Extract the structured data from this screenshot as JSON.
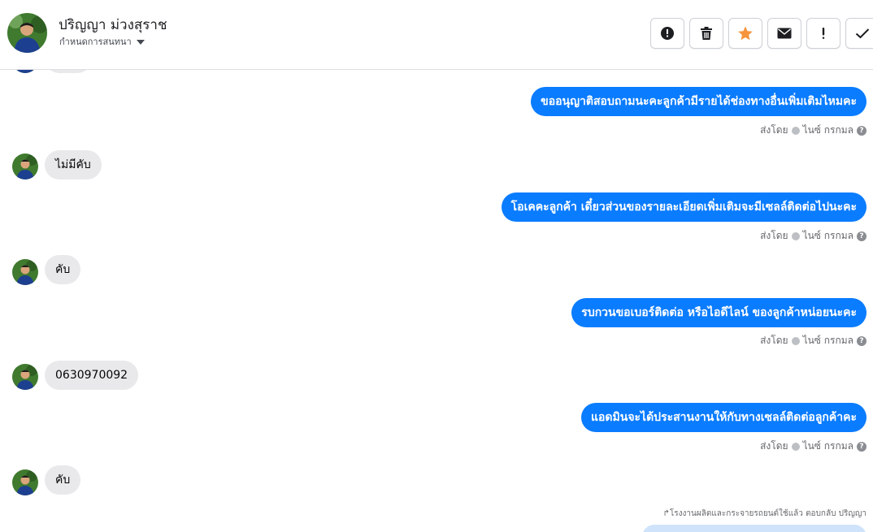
{
  "header": {
    "contact_name": "ปริญญา ม่วงสุราช",
    "assign_label": "กำหนดการสนทนา",
    "toolbar": [
      {
        "name": "spam-button",
        "icon": "alert-circle-icon"
      },
      {
        "name": "delete-button",
        "icon": "trash-icon"
      },
      {
        "name": "star-button",
        "icon": "star-icon"
      },
      {
        "name": "mark-unread-button",
        "icon": "envelope-icon"
      },
      {
        "name": "follow-up-button",
        "icon": "exclamation-icon"
      },
      {
        "name": "done-button",
        "icon": "check-icon"
      }
    ]
  },
  "colors": {
    "outgoing_bubble": "#0a7cff",
    "incoming_bubble": "#e9e9eb",
    "star": "#f5943d"
  },
  "messages": [
    {
      "dir": "out",
      "text": "ขออนุญาติสอบถามนะคะลูกค้ามีรายได้ช่องทางอื่นเพิ่มเติมไหมคะ",
      "sent_by": "ส่งโดย",
      "sender": "ไนซ์ กรกมล"
    },
    {
      "dir": "in",
      "text": "ไม่มีคับ"
    },
    {
      "dir": "out",
      "text": "โอเคคะลูกค้า เดี๋ยวส่วนของรายละเอียดเพิ่มเติมจะมีเซลล์ติดต่อไปนะคะ",
      "sent_by": "ส่งโดย",
      "sender": "ไนซ์ กรกมล"
    },
    {
      "dir": "in",
      "text": "คับ"
    },
    {
      "dir": "out",
      "text": "รบกวนขอเบอร์ติดต่อ หรือไอดีไลน์ ของลูกค้าหน่อยนะคะ",
      "sent_by": "ส่งโดย",
      "sender": "ไนซ์ กรกมล"
    },
    {
      "dir": "in",
      "text": "0630970092"
    },
    {
      "dir": "out",
      "text": "แอดมินจะได้ประสานงานให้กับทางเซลล์ติดต่อลูกค้าคะ",
      "sent_by": "ส่งโดย",
      "sender": "ไนซ์ กรกมล"
    },
    {
      "dir": "in",
      "text": "คับ"
    }
  ],
  "reply_note": "↱โรงงานผลิตและกระจายรถยนต์ใช้แล้ว ตอบกลับ ปริญญา"
}
